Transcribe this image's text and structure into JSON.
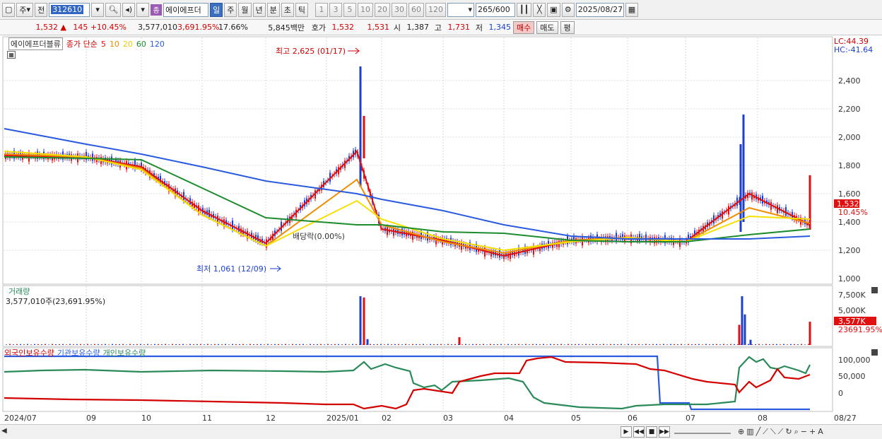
{
  "toolbar": {
    "period_main": "주",
    "prev_label": "전",
    "stock_code": "312610",
    "stock_name": "에이에프더",
    "stock_badge": "종",
    "periods": [
      "일",
      "주",
      "월",
      "년",
      "분",
      "초",
      "틱"
    ],
    "active_period": "일",
    "intervals": [
      "1",
      "3",
      "5",
      "10",
      "20",
      "30",
      "60",
      "120"
    ],
    "count_value": "265",
    "count_total": "/600",
    "date_value": "2025/08/27"
  },
  "quote": {
    "price": "1,532",
    "change_arrow": "▲",
    "change": "145",
    "change_pct": "+10.45%",
    "volume": "3,577,010",
    "volume_ratio": "3,691.95%",
    "turnover": "17.66%",
    "amount": "5,845백만",
    "ask_label": "호가",
    "ask1": "1,532",
    "ask2": "1,531",
    "open_label": "시",
    "open": "1,387",
    "high_label": "고",
    "high": "1,731",
    "low_label": "저",
    "low": "1,345",
    "buy_label": "매수",
    "sell_label": "매도",
    "avg_label": "평"
  },
  "legend": {
    "stock_tag": "에이에프더블류",
    "ma_prefix": "종가 단순",
    "ma_periods": [
      {
        "label": "5",
        "color": "#e01010"
      },
      {
        "label": "10",
        "color": "#f08c00"
      },
      {
        "label": "20",
        "color": "#f5e000"
      },
      {
        "label": "60",
        "color": "#1c8c2c"
      },
      {
        "label": "120",
        "color": "#2a5ae0"
      }
    ],
    "lc": "LC:44.39",
    "hc": "HC:-41.64"
  },
  "price_axis": {
    "ticks": [
      "2,400",
      "2,200",
      "2,000",
      "1,800",
      "1,600",
      "1,400",
      "1,200",
      "1,000"
    ],
    "current_price": "1,532",
    "current_change": "10.45%"
  },
  "annotations": {
    "high": "최고 2,625 (01/17)",
    "low": "최저 1,061 (12/09)",
    "dividend": "배당락(0.00%)"
  },
  "volume_panel": {
    "title": "거래량",
    "value": "3,577,010주(23,691.95%)",
    "ticks": [
      "7,500K",
      "5,000K",
      "2,500K"
    ],
    "current": "3,577K",
    "current_pct": "23691.95%"
  },
  "holdings_panel": {
    "series": [
      {
        "name": "외국인보유수량",
        "color": "#d40000"
      },
      {
        "name": "기관보유수량",
        "color": "#2a5ae0"
      },
      {
        "name": "개인보유수량",
        "color": "#2a8a5a"
      }
    ],
    "ticks": [
      "100,000",
      "50,000",
      "0"
    ]
  },
  "x_axis": {
    "labels": [
      "2024/07",
      "09",
      "10",
      "11",
      "12",
      "2025/01",
      "02",
      "03",
      "04",
      "05",
      "06",
      "07",
      "08",
      "08/27"
    ]
  },
  "icons": {
    "search": "search-icon",
    "speaker": "speaker-icon",
    "candle": "candlestick-icon",
    "save": "save-icon",
    "gear": "gear-icon",
    "calendar": "calendar-icon"
  },
  "chart_data": {
    "type": "line",
    "title": "",
    "xlabel": "",
    "ylabel": "",
    "ylim": [
      1000,
      2500
    ],
    "x": [
      "2024/07",
      "09",
      "10",
      "11",
      "12",
      "2025/01",
      "02",
      "03",
      "04",
      "05",
      "06",
      "07",
      "08",
      "08/27"
    ],
    "series": [
      {
        "name": "5",
        "values": [
          1870,
          1860,
          1790,
          1480,
          1250,
          1900,
          1350,
          1270,
          1160,
          1270,
          1290,
          1260,
          1600,
          1380
        ]
      },
      {
        "name": "10",
        "values": [
          1880,
          1860,
          1780,
          1450,
          1230,
          1700,
          1380,
          1260,
          1180,
          1270,
          1290,
          1260,
          1500,
          1390
        ]
      },
      {
        "name": "20",
        "values": [
          1900,
          1860,
          1770,
          1450,
          1230,
          1550,
          1420,
          1280,
          1200,
          1260,
          1290,
          1260,
          1440,
          1420
        ]
      },
      {
        "name": "60",
        "values": [
          1860,
          1850,
          1840,
          1640,
          1430,
          1380,
          1380,
          1330,
          1320,
          1270,
          1260,
          1260,
          1310,
          1350
        ]
      },
      {
        "name": "120",
        "values": [
          2060,
          1950,
          1880,
          1790,
          1690,
          1600,
          1560,
          1480,
          1380,
          1300,
          1280,
          1280,
          1280,
          1300
        ]
      }
    ]
  }
}
